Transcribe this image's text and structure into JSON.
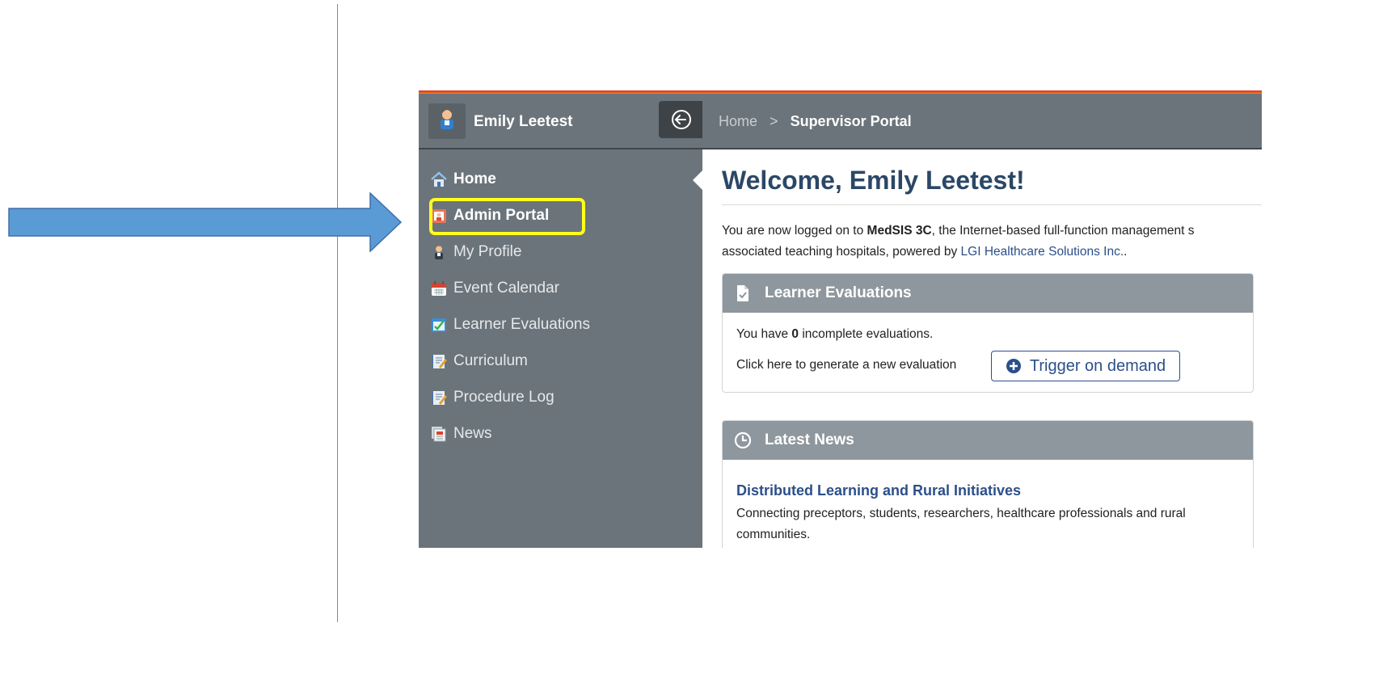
{
  "user": {
    "name": "Emily Leetest"
  },
  "breadcrumb": {
    "home": "Home",
    "separator": ">",
    "current": "Supervisor Portal"
  },
  "sidebar": {
    "items": [
      {
        "label": "Home",
        "icon": "home-icon"
      },
      {
        "label": "Admin Portal",
        "icon": "admin-icon"
      },
      {
        "label": "My Profile",
        "icon": "profile-icon"
      },
      {
        "label": "Event Calendar",
        "icon": "calendar-icon"
      },
      {
        "label": "Learner Evaluations",
        "icon": "evaluations-icon"
      },
      {
        "label": "Curriculum",
        "icon": "curriculum-icon"
      },
      {
        "label": "Procedure Log",
        "icon": "procedure-log-icon"
      },
      {
        "label": "News",
        "icon": "news-icon"
      }
    ]
  },
  "main": {
    "welcome": "Welcome, Emily Leetest!",
    "intro": {
      "part1": "You are now logged on to ",
      "product": "MedSIS 3C",
      "part2": ", the Internet-based full-function management s",
      "part3": "associated teaching hospitals, powered by ",
      "company": "LGI Healthcare Solutions Inc.",
      "part4": "."
    },
    "evaluations": {
      "title": "Learner Evaluations",
      "line1_prefix": "You have ",
      "count": "0",
      "line1_suffix": " incomplete evaluations.",
      "line2": "Click here to generate a new evaluation",
      "button": "Trigger on demand"
    },
    "news": {
      "title": "Latest News",
      "item_title": "Distributed Learning and Rural Initiatives",
      "item_desc": "Connecting preceptors, students, researchers, healthcare professionals and rural communities."
    }
  },
  "colors": {
    "arrow": "#5b9bd5",
    "highlight": "#ffff1a",
    "sidebar": "#6b747b",
    "title": "#2c4766",
    "link": "#2c4f8a"
  }
}
